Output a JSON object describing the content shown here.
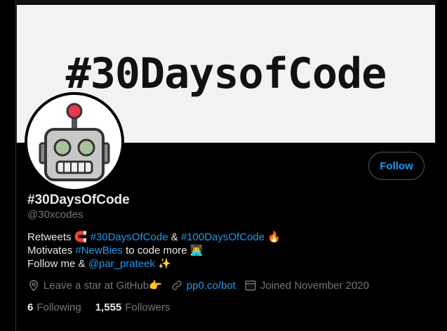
{
  "banner": {
    "text": "#30DaysofCode"
  },
  "profile": {
    "display_name": "#30DaysOfCode",
    "handle": "@30xcodes",
    "follow_label": "Follow"
  },
  "bio": {
    "line1": {
      "prefix": "Retweets",
      "emoji_magnet": "🧲",
      "tag1": "#30DaysOfCode",
      "amp": "&",
      "tag2": "#100DaysOfCode",
      "emoji_fire": "🔥"
    },
    "line2": {
      "prefix": "Motivates",
      "tag": "#NewBies",
      "suffix": "to code more",
      "emoji_coder": "👨‍💻"
    },
    "line3": {
      "prefix": "Follow me &",
      "mention": "@par_prateek",
      "emoji_sparkles": "✨"
    }
  },
  "meta": {
    "location": "Leave a star at GitHub👉",
    "website": "pp0.co/bot",
    "joined": "Joined November 2020"
  },
  "stats": {
    "following_count": "6",
    "following_label": "Following",
    "followers_count": "1,555",
    "followers_label": "Followers"
  },
  "colors": {
    "accent": "#1d9bf0",
    "muted": "#71767b",
    "background": "#000000"
  },
  "icons": [
    "location-pin-icon",
    "link-icon",
    "calendar-icon",
    "robot-avatar-icon"
  ]
}
